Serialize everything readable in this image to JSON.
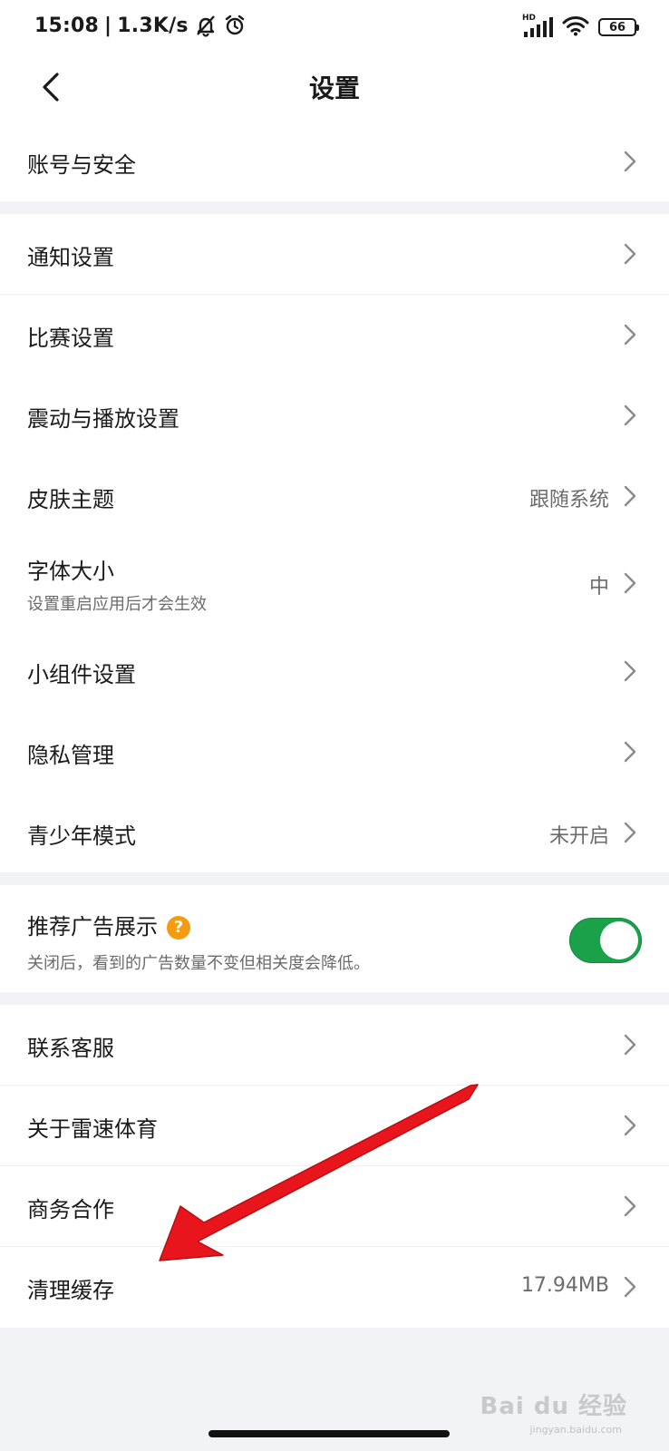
{
  "status_bar": {
    "time": "15:08",
    "speed": "1.3K/s",
    "network": "HD",
    "battery": "66"
  },
  "header": {
    "title": "设置"
  },
  "sections": {
    "account": {
      "account_security": "账号与安全"
    },
    "general": {
      "notification": "通知设置",
      "match": "比赛设置",
      "vibration_playback": "震动与播放设置",
      "skin_theme": "皮肤主题",
      "skin_theme_value": "跟随系统",
      "font_size": "字体大小",
      "font_size_note": "设置重启应用后才会生效",
      "font_size_value": "中",
      "widget": "小组件设置",
      "privacy": "隐私管理",
      "teen_mode": "青少年模式",
      "teen_mode_value": "未开启"
    },
    "ads": {
      "label": "推荐广告展示",
      "help_glyph": "?",
      "note": "关闭后，看到的广告数量不变但相关度会降低。",
      "enabled": true
    },
    "about": {
      "customer_service": "联系客服",
      "about_app": "关于雷速体育",
      "business": "商务合作",
      "clear_cache": "清理缓存",
      "cache_size": "17.94MB"
    }
  },
  "watermark": {
    "brand": "Bai du 经验",
    "url": "jingyan.baidu.com"
  },
  "colors": {
    "toggle_on": "#1aa14a",
    "help_icon": "#f39c12",
    "annotation_arrow": "#e8161c"
  }
}
